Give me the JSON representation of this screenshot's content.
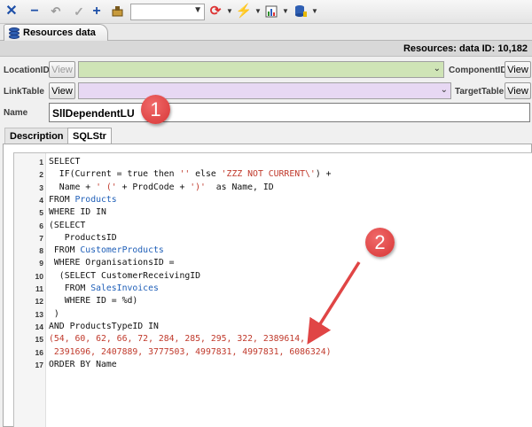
{
  "toolbar": {
    "icons": [
      "close-icon",
      "minus-icon",
      "undo-icon",
      "check-icon",
      "plus-icon",
      "broom-icon",
      "refresh-icon",
      "lightning-icon",
      "report-icon",
      "database-export-icon"
    ],
    "combo_value": ""
  },
  "tab": {
    "title": "Resources data"
  },
  "header": {
    "resources_id": "Resources: data ID: 10,182"
  },
  "form": {
    "location_label": "LocationID",
    "location_view": "View",
    "component_label": "ComponentID",
    "component_view": "View",
    "linktable_label": "LinkTable",
    "linktable_view": "View",
    "targettable_label": "TargetTable",
    "targettable_view": "View",
    "name_label": "Name",
    "name_value": "SllDependentLU"
  },
  "inner_tabs": [
    "Description",
    "SQLStr"
  ],
  "code": {
    "lines": [
      {
        "n": "1",
        "parts": [
          {
            "t": "SELECT"
          }
        ]
      },
      {
        "n": "2",
        "parts": [
          {
            "t": "  IF(Current = true then "
          },
          {
            "t": "''",
            "c": "str"
          },
          {
            "t": " else "
          },
          {
            "t": "'ZZZ NOT CURRENT\\'",
            "c": "str"
          },
          {
            "t": ") +"
          }
        ]
      },
      {
        "n": "3",
        "parts": [
          {
            "t": "  Name + "
          },
          {
            "t": "' ('",
            "c": "str"
          },
          {
            "t": " + ProdCode + "
          },
          {
            "t": "')'",
            "c": "str"
          },
          {
            "t": "  as Name, ID"
          }
        ]
      },
      {
        "n": "4",
        "parts": [
          {
            "t": "FROM "
          },
          {
            "t": "Products",
            "c": "tbl"
          }
        ]
      },
      {
        "n": "5",
        "parts": [
          {
            "t": "WHERE ID IN"
          }
        ]
      },
      {
        "n": "6",
        "parts": [
          {
            "t": "(SELECT"
          }
        ]
      },
      {
        "n": "7",
        "parts": [
          {
            "t": "   ProductsID"
          }
        ]
      },
      {
        "n": "8",
        "parts": [
          {
            "t": " FROM "
          },
          {
            "t": "CustomerProducts",
            "c": "tbl"
          }
        ]
      },
      {
        "n": "9",
        "parts": [
          {
            "t": " WHERE OrganisationsID ="
          }
        ]
      },
      {
        "n": "10",
        "parts": [
          {
            "t": "  (SELECT CustomerReceivingID"
          }
        ]
      },
      {
        "n": "11",
        "parts": [
          {
            "t": "   FROM "
          },
          {
            "t": "SalesInvoices",
            "c": "tbl"
          }
        ]
      },
      {
        "n": "12",
        "parts": [
          {
            "t": "   WHERE ID = %d)"
          }
        ]
      },
      {
        "n": "13",
        "parts": [
          {
            "t": " )"
          }
        ]
      },
      {
        "n": "14",
        "parts": [
          {
            "t": "AND ProductsTypeID IN"
          }
        ]
      },
      {
        "n": "15",
        "parts": [
          {
            "t": "(54, 60, 62, 66, 72, 284, 285, 295, 322, 2389614,",
            "c": "str"
          }
        ]
      },
      {
        "n": "16",
        "parts": [
          {
            "t": " 2391696, 2407889, 3777503, 4997831, 4997831, 6086324)",
            "c": "str"
          }
        ]
      },
      {
        "n": "17",
        "parts": [
          {
            "t": "ORDER BY Name"
          }
        ]
      }
    ]
  },
  "annotations": {
    "badge1": "1",
    "badge2": "2"
  },
  "colors": {
    "location_combo": "#cfe4b6",
    "linktable_combo": "#e7d8f3",
    "badge": "#dd3c3c",
    "arrow": "#e04545"
  }
}
